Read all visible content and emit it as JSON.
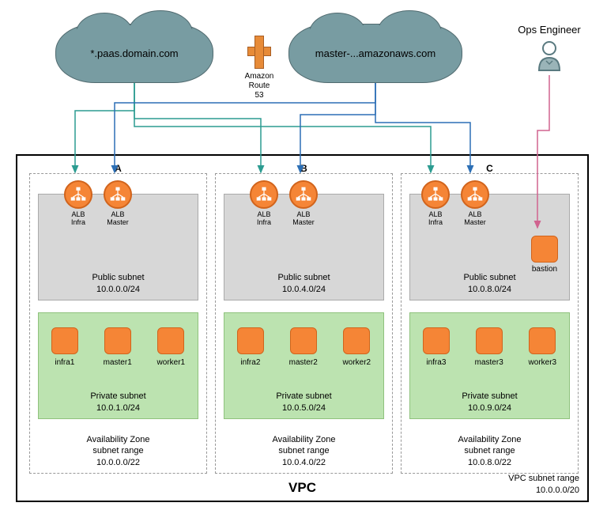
{
  "clouds": {
    "domain1": "*.paas.domain.com",
    "domain2": "master-...amazonaws.com"
  },
  "route53": {
    "name": "Amazon Route 53",
    "line1": "Amazon",
    "line2": "Route 53"
  },
  "ops": {
    "label": "Ops Engineer"
  },
  "vpc": {
    "title": "VPC",
    "range_label": "VPC subnet range",
    "range_value": "10.0.0.0/20"
  },
  "zones": [
    {
      "letter": "A",
      "az_label": "Availability Zone",
      "az_range_label": "subnet range",
      "az_range": "10.0.0.0/22",
      "public": {
        "label": "Public subnet",
        "cidr": "10.0.0.0/24",
        "albs": [
          {
            "l1": "ALB",
            "l2": "Infra"
          },
          {
            "l1": "ALB",
            "l2": "Master"
          }
        ]
      },
      "private": {
        "label": "Private subnet",
        "cidr": "10.0.1.0/24",
        "nodes": [
          "infra1",
          "master1",
          "worker1"
        ]
      },
      "has_bastion": false
    },
    {
      "letter": "B",
      "az_label": "Availability Zone",
      "az_range_label": "subnet range",
      "az_range": "10.0.4.0/22",
      "public": {
        "label": "Public subnet",
        "cidr": "10.0.4.0/24",
        "albs": [
          {
            "l1": "ALB",
            "l2": "Infra"
          },
          {
            "l1": "ALB",
            "l2": "Master"
          }
        ]
      },
      "private": {
        "label": "Private subnet",
        "cidr": "10.0.5.0/24",
        "nodes": [
          "infra2",
          "master2",
          "worker2"
        ]
      },
      "has_bastion": false
    },
    {
      "letter": "C",
      "az_label": "Availability Zone",
      "az_range_label": "subnet range",
      "az_range": "10.0.8.0/22",
      "public": {
        "label": "Public subnet",
        "cidr": "10.0.8.0/24",
        "albs": [
          {
            "l1": "ALB",
            "l2": "Infra"
          },
          {
            "l1": "ALB",
            "l2": "Master"
          }
        ]
      },
      "private": {
        "label": "Private subnet",
        "cidr": "10.0.9.0/24",
        "nodes": [
          "infra3",
          "master3",
          "worker3"
        ]
      },
      "has_bastion": true,
      "bastion_label": "bastion"
    }
  ],
  "colors": {
    "cloud": "#789ca2",
    "aws_orange": "#f58536",
    "teal_arrow": "#2c9c91",
    "blue_arrow": "#2c6fb5",
    "pink_arrow": "#d0638f"
  }
}
